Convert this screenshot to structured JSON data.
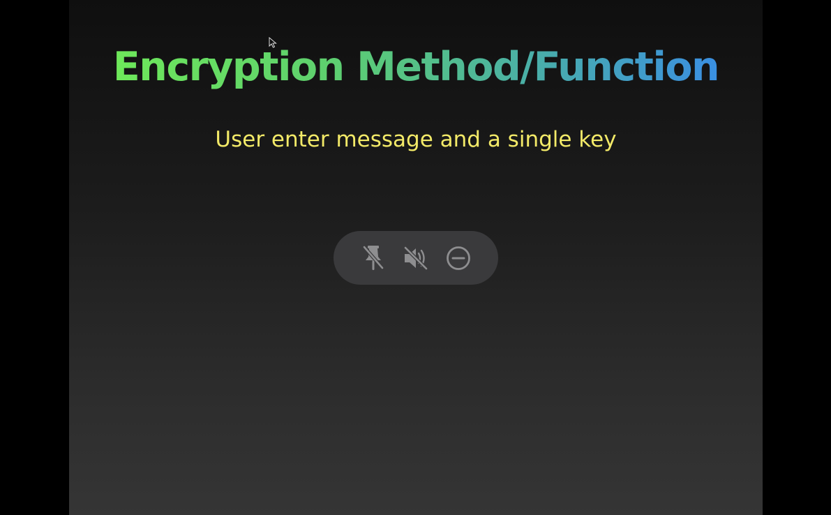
{
  "slide": {
    "title": "Encryption Method/Function",
    "subtitle": "User enter message and a single key"
  },
  "control_bar": {
    "buttons": [
      {
        "icon": "unpin-icon"
      },
      {
        "icon": "mute-icon"
      },
      {
        "icon": "minus-circle-icon"
      }
    ]
  },
  "colors": {
    "title_gradient_start": "#6ee85a",
    "title_gradient_end": "#3a8fe2",
    "subtitle": "#f3ea68",
    "control_bar_bg": "#3a3a3c",
    "icon": "#8e8e90"
  }
}
